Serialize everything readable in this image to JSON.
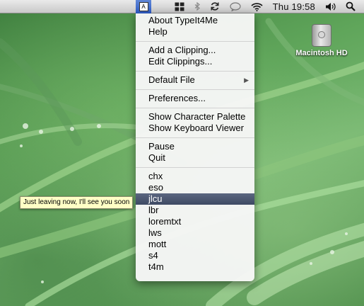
{
  "menubar": {
    "typeit_icon": "A",
    "clock": "Thu 19:58",
    "icons": [
      "typeit4me-icon",
      "grid-icon",
      "bluetooth-icon",
      "sync-icon",
      "speech-bubble-icon",
      "wifi-icon",
      "volume-icon",
      "spotlight-search-icon"
    ]
  },
  "desktop": {
    "drive_label": "Macintosh HD"
  },
  "menu": {
    "group1": [
      "About TypeIt4Me",
      "Help"
    ],
    "group2": [
      "Add a Clipping...",
      "Edit Clippings..."
    ],
    "group3": [
      "Default File"
    ],
    "group4": [
      "Preferences..."
    ],
    "group5": [
      "Show Character Palette",
      "Show Keyboard Viewer"
    ],
    "group6": [
      "Pause",
      "Quit"
    ],
    "clippings": [
      "chx",
      "eso",
      "jlcu",
      "lbr",
      "loremtxt",
      "lws",
      "mott",
      "s4",
      "t4m"
    ],
    "highlighted": "jlcu"
  },
  "tooltip": "Just leaving now, I'll see you soon",
  "colors": {
    "highlight": "#4a5670",
    "tooltip_bg": "#ffffc6"
  }
}
